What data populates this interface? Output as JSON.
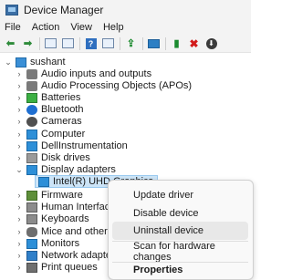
{
  "window": {
    "title": "Device Manager"
  },
  "menubar": {
    "items": [
      "File",
      "Action",
      "View",
      "Help"
    ]
  },
  "toolbar": {
    "buttons": [
      {
        "name": "back-icon"
      },
      {
        "name": "forward-icon"
      },
      {
        "name": "properties-icon"
      },
      {
        "name": "show-hidden-icon"
      },
      {
        "name": "help-icon",
        "glyph": "?"
      },
      {
        "name": "view-icon"
      },
      {
        "name": "update-driver-icon"
      },
      {
        "name": "scan-hardware-icon"
      },
      {
        "name": "enable-device-icon"
      },
      {
        "name": "uninstall-device-icon",
        "glyph": "✖"
      },
      {
        "name": "disable-device-icon",
        "glyph": "⬇"
      }
    ]
  },
  "tree": {
    "root": "sushant",
    "categories": [
      "Audio inputs and outputs",
      "Audio Processing Objects (APOs)",
      "Batteries",
      "Bluetooth",
      "Cameras",
      "Computer",
      "DellInstrumentation",
      "Disk drives",
      "Display adapters",
      "Intel(R) UHD Graphics",
      "Firmware",
      "Human Interface De",
      "Keyboards",
      "Mice and other poin",
      "Monitors",
      "Network adapters",
      "Print queues"
    ]
  },
  "context_menu": {
    "items": [
      "Update driver",
      "Disable device",
      "Uninstall device",
      "Scan for hardware changes",
      "Properties"
    ]
  },
  "colors": {
    "selection": "#cce4f7",
    "menu_bg": "#f9f9f9",
    "chrome_bg": "#f3f3f3"
  }
}
